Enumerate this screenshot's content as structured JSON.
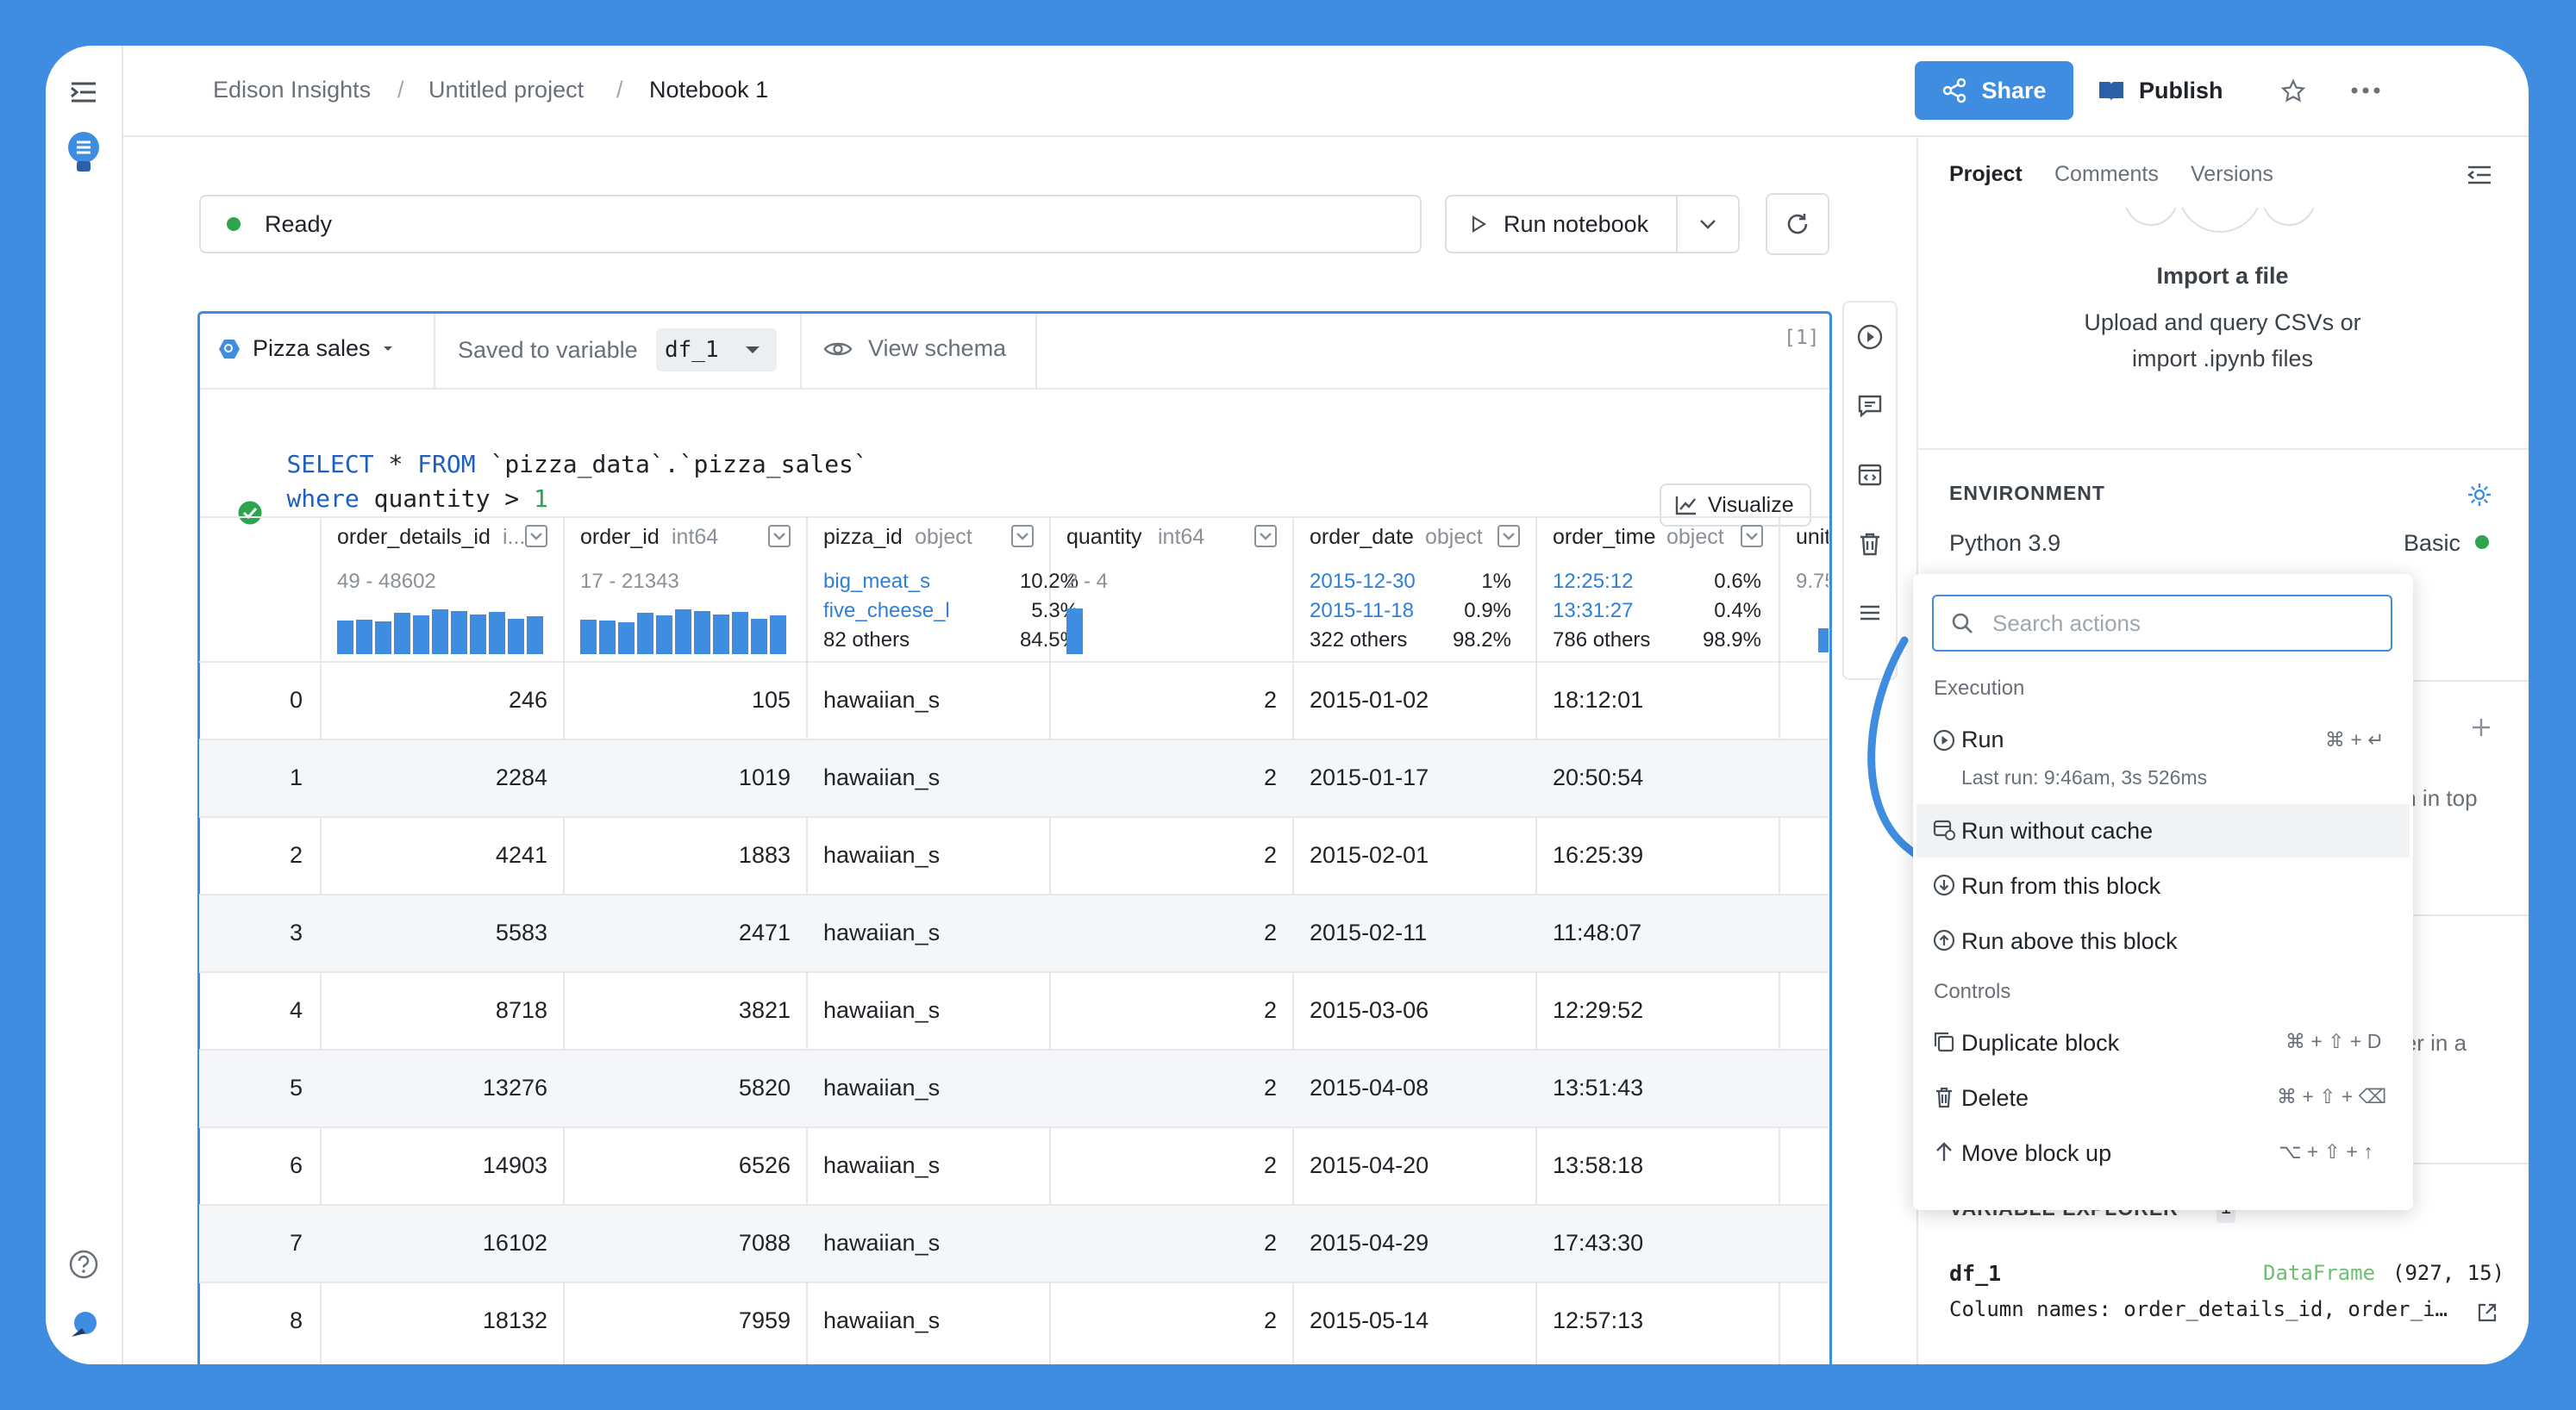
{
  "breadcrumb": {
    "org": "Edison Insights",
    "project": "Untitled project",
    "notebook": "Notebook 1",
    "sep": "/"
  },
  "header": {
    "share_label": "Share",
    "publish_label": "Publish"
  },
  "status": {
    "text": "Ready",
    "color": "#2ea44f"
  },
  "toolbar": {
    "run_notebook_label": "Run notebook"
  },
  "block": {
    "source_name": "Pizza sales",
    "saved_to_label": "Saved to variable",
    "variable": "df_1",
    "view_schema_label": "View schema",
    "exec_count": "[1]",
    "sql_line1": [
      "SELECT",
      " * ",
      "FROM",
      " `pizza_data`.`pizza_sales`"
    ],
    "sql_line2": [
      "where",
      " quantity > ",
      "1"
    ],
    "visualize_label": "Visualize"
  },
  "columns": [
    {
      "name": "order_details_id",
      "type": "i...",
      "range": "49 - 48602",
      "hist": [
        0.7,
        0.72,
        0.68,
        0.85,
        0.8,
        0.92,
        0.9,
        0.82,
        0.88,
        0.74,
        0.78
      ]
    },
    {
      "name": "order_id",
      "type": "int64",
      "range": "17 - 21343",
      "hist": [
        0.72,
        0.7,
        0.66,
        0.85,
        0.8,
        0.92,
        0.9,
        0.82,
        0.88,
        0.74,
        0.8
      ]
    },
    {
      "name": "pizza_id",
      "type": "object",
      "top": [
        {
          "label": "big_meat_s",
          "pct": "10.2%"
        },
        {
          "label": "five_cheese_l",
          "pct": "5.3%"
        }
      ],
      "others": "82 others",
      "others_pct": "84.5%"
    },
    {
      "name": "quantity",
      "type": "int64",
      "range": "2 - 4",
      "hist": [
        0.95
      ]
    },
    {
      "name": "order_date",
      "type": "object",
      "top": [
        {
          "label": "2015-12-30",
          "pct": "1%"
        },
        {
          "label": "2015-11-18",
          "pct": "0.9%"
        }
      ],
      "others": "322 others",
      "others_pct": "98.2%"
    },
    {
      "name": "order_time",
      "type": "object",
      "top": [
        {
          "label": "12:25:12",
          "pct": "0.6%"
        },
        {
          "label": "13:31:27",
          "pct": "0.4%"
        }
      ],
      "others": "786 others",
      "others_pct": "98.9%"
    },
    {
      "name": "unit",
      "range": "9.75"
    }
  ],
  "rows": [
    {
      "idx": "0",
      "order_details_id": "246",
      "order_id": "105",
      "pizza_id": "hawaiian_s",
      "quantity": "2",
      "order_date": "2015-01-02",
      "order_time": "18:12:01"
    },
    {
      "idx": "1",
      "order_details_id": "2284",
      "order_id": "1019",
      "pizza_id": "hawaiian_s",
      "quantity": "2",
      "order_date": "2015-01-17",
      "order_time": "20:50:54"
    },
    {
      "idx": "2",
      "order_details_id": "4241",
      "order_id": "1883",
      "pizza_id": "hawaiian_s",
      "quantity": "2",
      "order_date": "2015-02-01",
      "order_time": "16:25:39"
    },
    {
      "idx": "3",
      "order_details_id": "5583",
      "order_id": "2471",
      "pizza_id": "hawaiian_s",
      "quantity": "2",
      "order_date": "2015-02-11",
      "order_time": "11:48:07"
    },
    {
      "idx": "4",
      "order_details_id": "8718",
      "order_id": "3821",
      "pizza_id": "hawaiian_s",
      "quantity": "2",
      "order_date": "2015-03-06",
      "order_time": "12:29:52"
    },
    {
      "idx": "5",
      "order_details_id": "13276",
      "order_id": "5820",
      "pizza_id": "hawaiian_s",
      "quantity": "2",
      "order_date": "2015-04-08",
      "order_time": "13:51:43"
    },
    {
      "idx": "6",
      "order_details_id": "14903",
      "order_id": "6526",
      "pizza_id": "hawaiian_s",
      "quantity": "2",
      "order_date": "2015-04-20",
      "order_time": "13:58:18"
    },
    {
      "idx": "7",
      "order_details_id": "16102",
      "order_id": "7088",
      "pizza_id": "hawaiian_s",
      "quantity": "2",
      "order_date": "2015-04-29",
      "order_time": "17:43:30"
    },
    {
      "idx": "8",
      "order_details_id": "18132",
      "order_id": "7959",
      "pizza_id": "hawaiian_s",
      "quantity": "2",
      "order_date": "2015-05-14",
      "order_time": "12:57:13"
    }
  ],
  "sidebar": {
    "tabs": [
      "Project",
      "Comments",
      "Versions"
    ],
    "import_title": "Import a file",
    "import_desc1": "Upload and query CSVs or",
    "import_desc2": "import .ipynb files",
    "env_heading": "ENVIRONMENT",
    "env_python": "Python 3.9",
    "env_tier": "Basic",
    "partial1": "icon in top",
    "partial2": "ler in a",
    "var_heading": "VARIABLE EXPLORER",
    "var_count": "1",
    "var_name": "df_1",
    "var_type": "DataFrame",
    "var_shape": "(927, 15)",
    "var_columns": "Column names: order_details_id, order_i…"
  },
  "actions_menu": {
    "search_placeholder": "Search actions",
    "section_execution": "Execution",
    "run": "Run",
    "run_shortcut": "⌘ + ↵",
    "last_run": "Last run: 9:46am, 3s 526ms",
    "run_without_cache": "Run without cache",
    "run_from": "Run from this block",
    "run_above": "Run above this block",
    "section_controls": "Controls",
    "duplicate": "Duplicate block",
    "duplicate_shortcut": "⌘ + ⇧ + D",
    "delete": "Delete",
    "delete_shortcut": "⌘ + ⇧ + ⌫",
    "move_up": "Move block up",
    "move_up_shortcut": "⌥ + ⇧ + ↑"
  },
  "colors": {
    "accent": "#3f8de1",
    "keyword": "#1f5fbf",
    "number": "#2ea44f",
    "link": "#2f7fd8"
  }
}
